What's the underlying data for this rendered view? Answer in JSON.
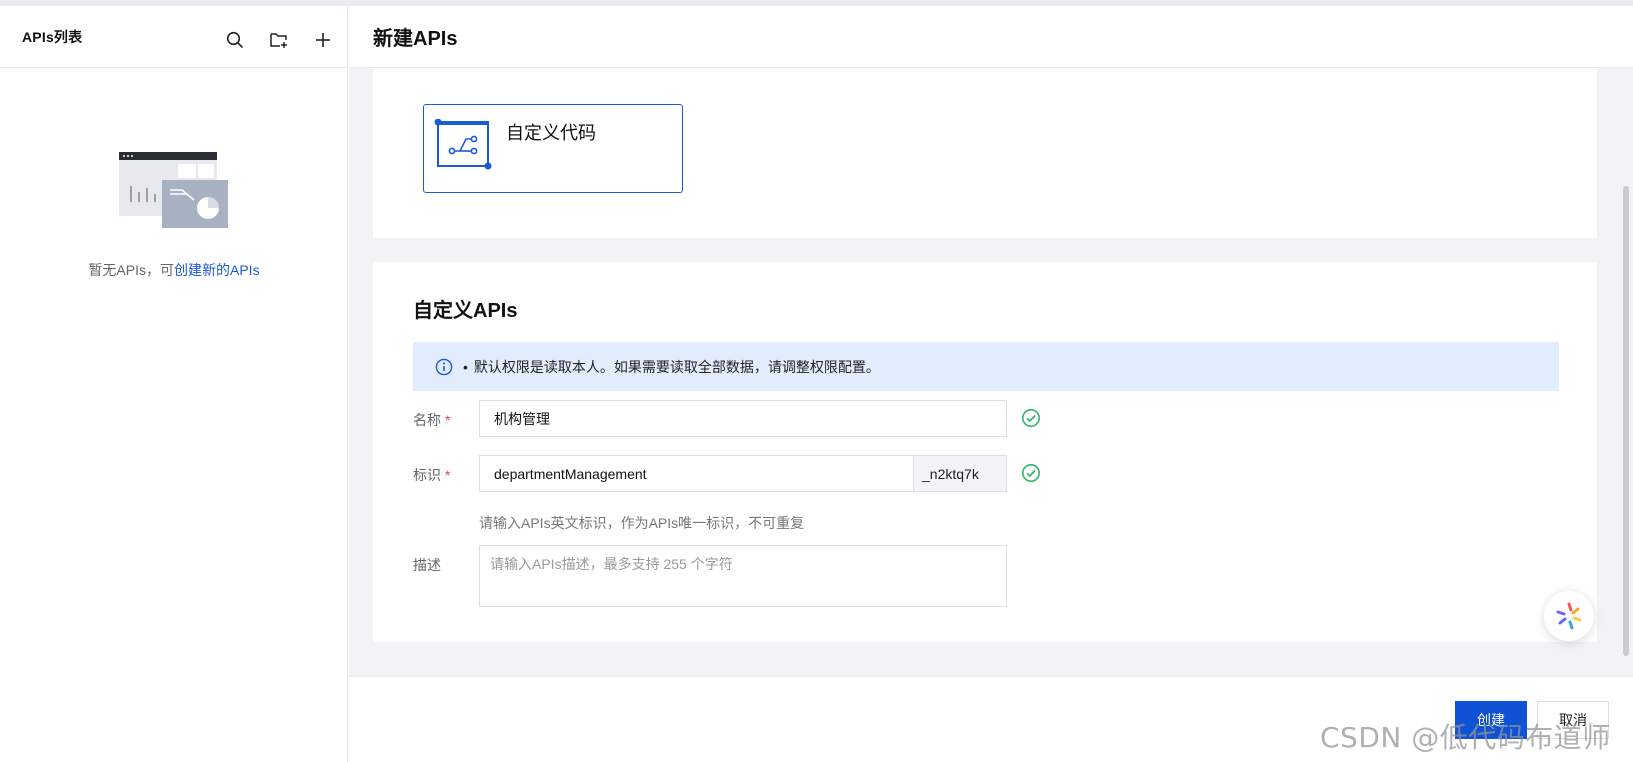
{
  "sidebar": {
    "title": "APIs列表",
    "empty_text": "暂无APIs，可",
    "empty_link": "创建新的APIs"
  },
  "header": {
    "title": "新建APIs"
  },
  "option_card": {
    "label": "自定义代码"
  },
  "form": {
    "section_title": "自定义APIs",
    "notice": "默认权限是读取本人。如果需要读取全部数据，请调整权限配置。",
    "notice_bullet": "•",
    "name_label": "名称",
    "name_value": "机构管理",
    "id_label": "标识",
    "id_value": "departmentManagement",
    "id_suffix": "_n2ktq7k",
    "id_hint": "请输入APIs英文标识，作为APIs唯一标识，不可重复",
    "desc_label": "描述",
    "desc_placeholder": "请输入APIs描述，最多支持 255 个字符",
    "required_mark": "*"
  },
  "footer": {
    "create_label": "创建",
    "cancel_label": "取消"
  },
  "watermark": "CSDN @低代码布道师",
  "colors": {
    "accent": "#0f52d4",
    "success": "#2bb86a",
    "notice_bg": "#e3ecfd",
    "required": "#e04242"
  },
  "icons": [
    "search-icon",
    "new-folder-icon",
    "plus-icon",
    "info-icon",
    "check-circle-icon",
    "custom-code-icon",
    "assistant-icon"
  ]
}
